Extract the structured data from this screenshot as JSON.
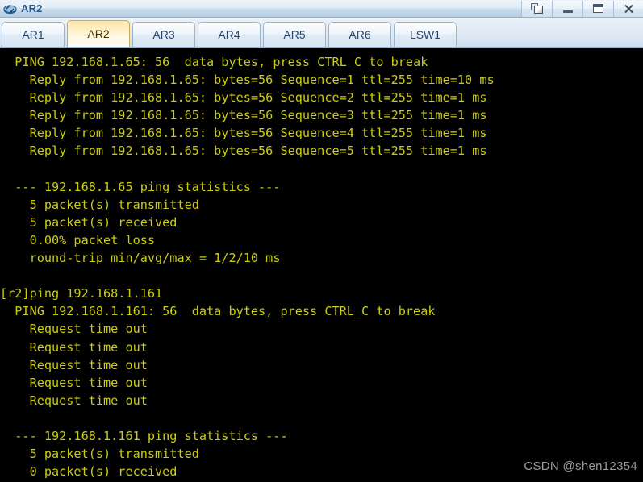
{
  "window": {
    "title": "AR2",
    "icon": "router-icon",
    "controls": [
      {
        "name": "restore-button",
        "icon": "restore-icon",
        "label": "Restore"
      },
      {
        "name": "minimize-button",
        "icon": "minimize-icon",
        "label": "Minimize"
      },
      {
        "name": "maximize-button",
        "icon": "maximize-icon",
        "label": "Maximize"
      },
      {
        "name": "close-button",
        "icon": "close-icon",
        "label": "Close"
      }
    ]
  },
  "tabs": {
    "active_index": 1,
    "items": [
      {
        "label": "AR1"
      },
      {
        "label": "AR2"
      },
      {
        "label": "AR3"
      },
      {
        "label": "AR4"
      },
      {
        "label": "AR5"
      },
      {
        "label": "AR6"
      },
      {
        "label": "LSW1"
      }
    ]
  },
  "terminal": {
    "background_color": "#000000",
    "text_color": "#cccc11",
    "lines": [
      "  PING 192.168.1.65: 56  data bytes, press CTRL_C to break",
      "    Reply from 192.168.1.65: bytes=56 Sequence=1 ttl=255 time=10 ms",
      "    Reply from 192.168.1.65: bytes=56 Sequence=2 ttl=255 time=1 ms",
      "    Reply from 192.168.1.65: bytes=56 Sequence=3 ttl=255 time=1 ms",
      "    Reply from 192.168.1.65: bytes=56 Sequence=4 ttl=255 time=1 ms",
      "    Reply from 192.168.1.65: bytes=56 Sequence=5 ttl=255 time=1 ms",
      "",
      "  --- 192.168.1.65 ping statistics ---",
      "    5 packet(s) transmitted",
      "    5 packet(s) received",
      "    0.00% packet loss",
      "    round-trip min/avg/max = 1/2/10 ms",
      "",
      "[r2]ping 192.168.1.161",
      "  PING 192.168.1.161: 56  data bytes, press CTRL_C to break",
      "    Request time out",
      "    Request time out",
      "    Request time out",
      "    Request time out",
      "    Request time out",
      "",
      "  --- 192.168.1.161 ping statistics ---",
      "    5 packet(s) transmitted",
      "    0 packet(s) received"
    ]
  },
  "watermark": {
    "text": "CSDN @shen12354"
  }
}
